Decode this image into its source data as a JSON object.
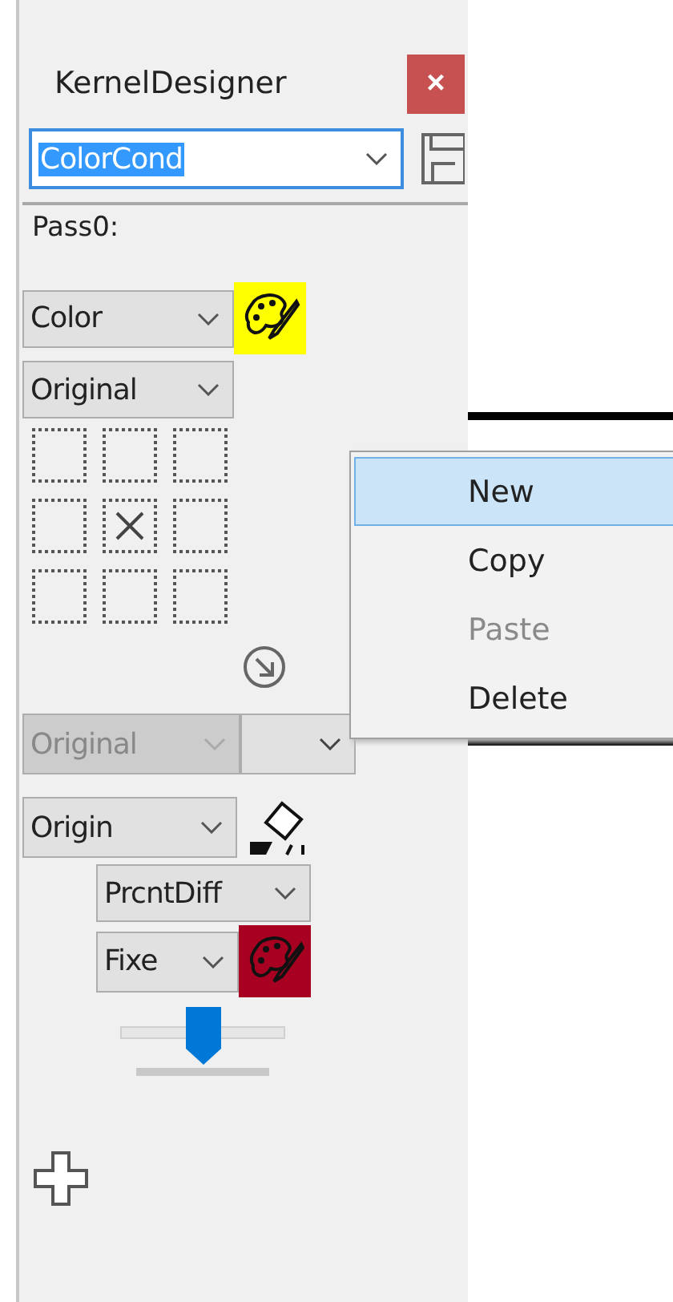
{
  "window": {
    "title": "KernelDesigner",
    "close": "×"
  },
  "kernel_select": {
    "value": "ColorCond",
    "highlighted": true
  },
  "pass": {
    "label": "Pass0:"
  },
  "channel_select": {
    "value": "Color",
    "color": "#ffff00"
  },
  "source_select": {
    "value": "Original"
  },
  "kernel_cells": [
    {
      "kind": "empty"
    },
    {
      "kind": "empty"
    },
    {
      "kind": "empty"
    },
    {
      "kind": "empty"
    },
    {
      "kind": "center"
    },
    {
      "kind": "empty"
    },
    {
      "kind": "empty"
    },
    {
      "kind": "empty"
    },
    {
      "kind": "empty"
    }
  ],
  "disabled_row": [
    {
      "value": "Original",
      "disabled": true
    },
    {
      "disabled": false
    }
  ],
  "blend_select": {
    "value": "Origin"
  },
  "diff_select": {
    "value": "PrcntDiff"
  },
  "mode_select": {
    "value": "Fixe",
    "color": "#a80020"
  },
  "slider": {
    "level": 0.5
  },
  "context_menu": [
    {
      "label": "New",
      "selected": true,
      "disabled": false
    },
    {
      "label": "Copy",
      "selected": false,
      "disabled": false
    },
    {
      "label": "Paste",
      "selected": false,
      "disabled": true
    },
    {
      "label": "Delete",
      "selected": false,
      "disabled": false
    }
  ]
}
